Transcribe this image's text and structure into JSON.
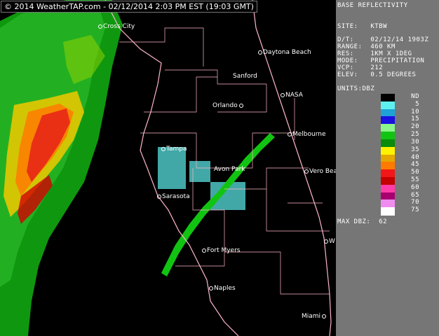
{
  "timestamp": "© 2014 WeatherTAP.com - 02/12/2014  2:03 PM EST (19:03 GMT)",
  "panel": {
    "title": "BASE REFLECTIVITY",
    "site_label": "SITE:",
    "site": "KTBW",
    "dt_label": "D/T:",
    "dt": "02/12/14 1903Z",
    "range_label": "RANGE:",
    "range": "460 KM",
    "res_label": "RES:",
    "res": "1KM X 1DEG",
    "mode_label": "MODE:",
    "mode": "PRECIPITATION",
    "vcp_label": "VCP:",
    "vcp": "212",
    "elev_label": "ELEV:",
    "elev": "0.5 DEGREES",
    "units_label": "UNITS:",
    "units": "DBZ",
    "max_label": "MAX DBZ:",
    "max_value": "62"
  },
  "legend": {
    "labels": [
      "ND",
      "5",
      "10",
      "15",
      "20",
      "25",
      "30",
      "35",
      "40",
      "45",
      "50",
      "55",
      "60",
      "65",
      "70",
      "75"
    ],
    "colors": [
      "#000000",
      "#5ef0ee",
      "#1fa2d5",
      "#1a10e0",
      "#8af58a",
      "#12c412",
      "#0b8c0b",
      "#fef300",
      "#e5a800",
      "#ff7a00",
      "#f21818",
      "#c40000",
      "#ff3ca8",
      "#a8006e",
      "#f08cf0",
      "#ffffff"
    ]
  },
  "cities": [
    {
      "name": "Cross City"
    },
    {
      "name": "Daytona Beach"
    },
    {
      "name": "Sanford"
    },
    {
      "name": "NASA"
    },
    {
      "name": "Orlando"
    },
    {
      "name": "Melbourne"
    },
    {
      "name": "Tampa"
    },
    {
      "name": "Avon Park"
    },
    {
      "name": "Vero Beach"
    },
    {
      "name": "Sarasota"
    },
    {
      "name": "W"
    },
    {
      "name": "Fort Myers"
    },
    {
      "name": "Naples"
    },
    {
      "name": "Miami"
    }
  ]
}
